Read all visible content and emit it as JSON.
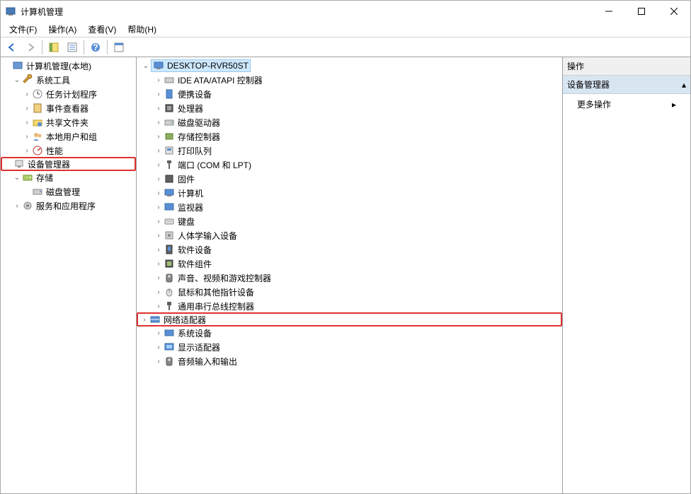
{
  "window": {
    "title": "计算机管理"
  },
  "menu": {
    "file": "文件(F)",
    "action": "操作(A)",
    "view": "查看(V)",
    "help": "帮助(H)"
  },
  "left_tree": {
    "root": "计算机管理(本地)",
    "system_tools": "系统工具",
    "task_scheduler": "任务计划程序",
    "event_viewer": "事件查看器",
    "shared_folders": "共享文件夹",
    "local_users": "本地用户和组",
    "performance": "性能",
    "device_manager": "设备管理器",
    "storage": "存储",
    "disk_management": "磁盘管理",
    "services_apps": "服务和应用程序"
  },
  "mid_tree": {
    "computer": "DESKTOP-RVR50ST",
    "items": [
      "IDE ATA/ATAPI 控制器",
      "便携设备",
      "处理器",
      "磁盘驱动器",
      "存储控制器",
      "打印队列",
      "端口 (COM 和 LPT)",
      "固件",
      "计算机",
      "监视器",
      "键盘",
      "人体学输入设备",
      "软件设备",
      "软件组件",
      "声音、视频和游戏控制器",
      "鼠标和其他指针设备",
      "通用串行总线控制器",
      "网络适配器",
      "系统设备",
      "显示适配器",
      "音频输入和输出"
    ]
  },
  "right": {
    "header": "操作",
    "section": "设备管理器",
    "more_actions": "更多操作"
  }
}
